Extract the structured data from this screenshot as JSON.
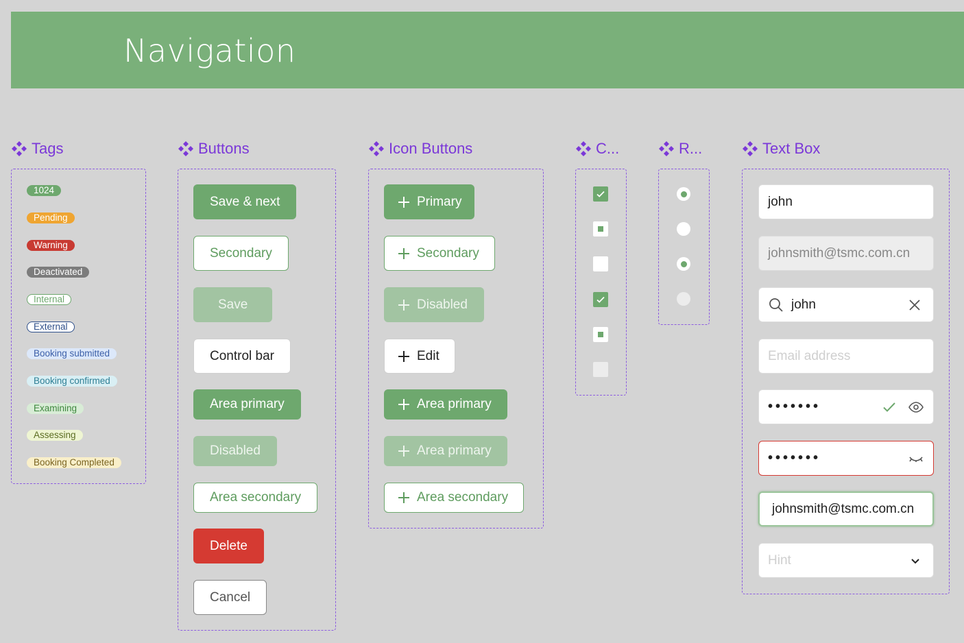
{
  "banner": {
    "title": "Navigation"
  },
  "sections": {
    "tags": "Tags",
    "buttons": "Buttons",
    "icon_buttons": "Icon Buttons",
    "checkbox": "C...",
    "radio": "R...",
    "text_box": "Text Box"
  },
  "tags": [
    {
      "label": "1024",
      "style": "success"
    },
    {
      "label": "Pending",
      "style": "pending"
    },
    {
      "label": "Warning",
      "style": "warning"
    },
    {
      "label": "Deactivated",
      "style": "deactivated"
    },
    {
      "label": "Internal",
      "style": "internal"
    },
    {
      "label": "External",
      "style": "external"
    },
    {
      "label": "Booking submitted",
      "style": "submitted"
    },
    {
      "label": "Booking confirmed",
      "style": "confirmed"
    },
    {
      "label": "Examining",
      "style": "examining"
    },
    {
      "label": "Assessing",
      "style": "assessing"
    },
    {
      "label": "Booking Completed",
      "style": "completed"
    }
  ],
  "buttons": {
    "save_next": "Save & next",
    "secondary": "Secondary",
    "save": "Save",
    "control_bar": "Control bar",
    "area_primary": "Area primary",
    "disabled": "Disabled",
    "area_secondary": "Area secondary",
    "delete": "Delete",
    "cancel": "Cancel"
  },
  "icon_buttons": {
    "primary": "Primary",
    "secondary": "Secondary",
    "disabled": "Disabled",
    "edit": "Edit",
    "area_primary": "Area primary",
    "area_primary_disabled": "Area primary",
    "area_secondary": "Area secondary"
  },
  "text_box": {
    "name_value": "john",
    "disabled_value": "johnsmith@tsmc.com.cn",
    "search_value": "john",
    "email_placeholder": "Email address",
    "password_mask": "•••••••",
    "password_error_mask": "•••••••",
    "focused_value": "johnsmith@tsmc.com.cn",
    "select_placeholder": "Hint"
  },
  "colors": {
    "primary_green": "#6ea86e",
    "banner_green": "#7ab07a",
    "accent_purple": "#7b38d8",
    "danger_red": "#d53a32"
  }
}
